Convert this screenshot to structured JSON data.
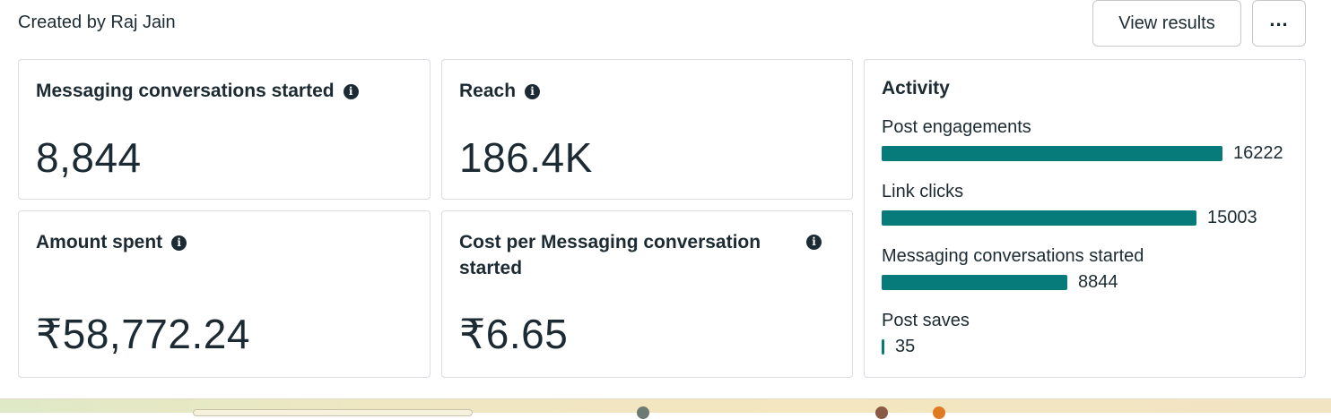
{
  "header": {
    "title": "Created by Raj Jain",
    "view_results_label": "View results",
    "more_label": "..."
  },
  "cards": {
    "messaging": {
      "label": "Messaging conversations started",
      "value": "8,844"
    },
    "reach": {
      "label": "Reach",
      "value": "186.4K"
    },
    "amount": {
      "label": "Amount spent",
      "value": "₹58,772.24"
    },
    "cost": {
      "label": "Cost per Messaging conversation started",
      "value": "₹6.65"
    }
  },
  "activity": {
    "title": "Activity",
    "bar_color": "#077a7a",
    "max_value": 16222,
    "rows": [
      {
        "label": "Post engagements",
        "value": 16222
      },
      {
        "label": "Link clicks",
        "value": 15003
      },
      {
        "label": "Messaging conversations started",
        "value": 8844
      },
      {
        "label": "Post saves",
        "value": 35
      }
    ]
  }
}
